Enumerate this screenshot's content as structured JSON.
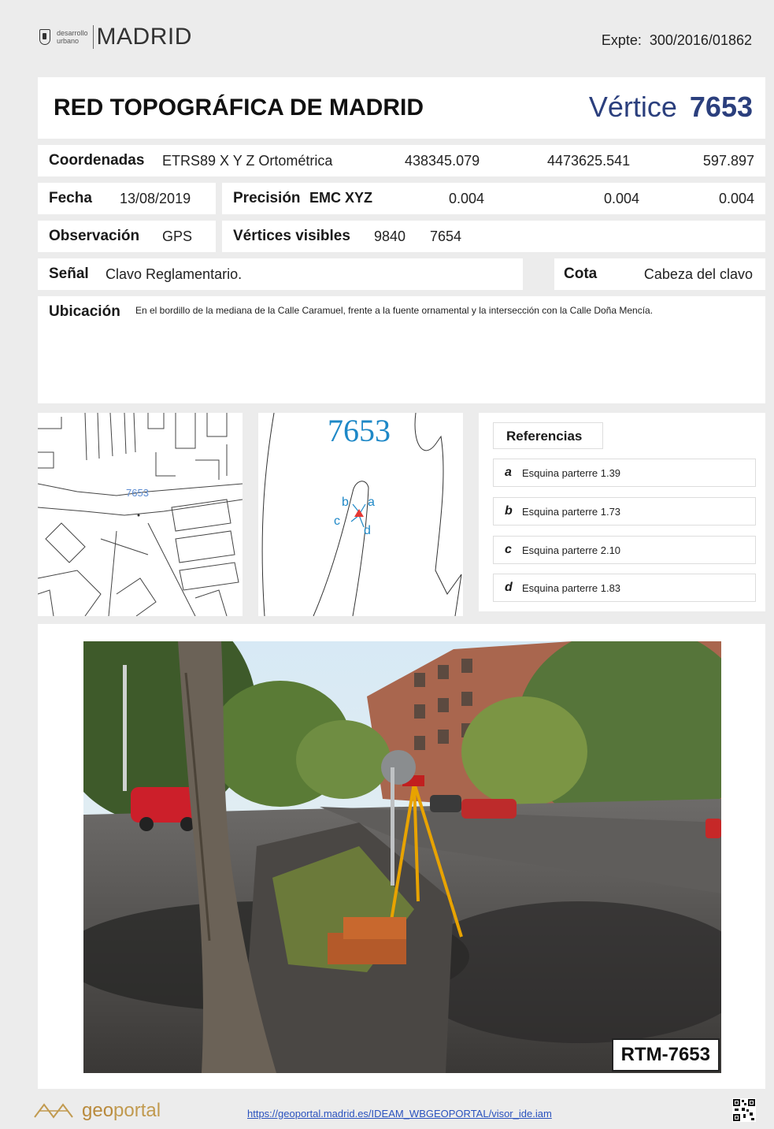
{
  "header": {
    "logo_small_line1": "desarrollo",
    "logo_small_line2": "urbano",
    "logo_main": "MADRID",
    "expte_label": "Expte:",
    "expte_value": "300/2016/01862"
  },
  "title": {
    "main": "RED TOPOGRÁFICA DE MADRID",
    "vertice_label": "Vértice",
    "vertice_number": "7653"
  },
  "coordinates": {
    "label": "Coordenadas",
    "system": "ETRS89 X Y Z Ortométrica",
    "x": "438345.079",
    "y": "4473625.541",
    "z": "597.897"
  },
  "fecha": {
    "label": "Fecha",
    "value": "13/08/2019"
  },
  "precision": {
    "label": "Precisión",
    "system": "EMC XYZ",
    "x": "0.004",
    "y": "0.004",
    "z": "0.004"
  },
  "observacion": {
    "label": "Observación",
    "value": "GPS"
  },
  "vertices_visibles": {
    "label": "Vértices visibles",
    "v1": "9840",
    "v2": "7654"
  },
  "senal": {
    "label": "Señal",
    "value": "Clavo Reglamentario."
  },
  "cota": {
    "label": "Cota",
    "value": "Cabeza del clavo"
  },
  "ubicacion": {
    "label": "Ubicación",
    "text": "En el bordillo de la mediana de la Calle Caramuel, frente a la fuente ornamental y la intersección con la Calle Doña Mencía."
  },
  "map1": {
    "vertex_label": "7653"
  },
  "map2": {
    "title": "7653",
    "points": {
      "a": "a",
      "b": "b",
      "c": "c",
      "d": "d"
    }
  },
  "referencias": {
    "title": "Referencias",
    "items": [
      {
        "key": "a",
        "text": "Esquina parterre 1.39"
      },
      {
        "key": "b",
        "text": "Esquina parterre 1.73"
      },
      {
        "key": "c",
        "text": "Esquina parterre 2.10"
      },
      {
        "key": "d",
        "text": "Esquina parterre 1.83"
      }
    ]
  },
  "photo": {
    "caption": "RTM-7653"
  },
  "footer": {
    "geoportal_geo": "geo",
    "geoportal_portal": "portal",
    "link": "https://geoportal.madrid.es/IDEAM_WBGEOPORTAL/visor_ide.iam"
  },
  "colors": {
    "accent": "#2b3f7d",
    "vertex_marker": "#e53935",
    "map_blue": "#1e88c7",
    "link": "#2a52be"
  }
}
